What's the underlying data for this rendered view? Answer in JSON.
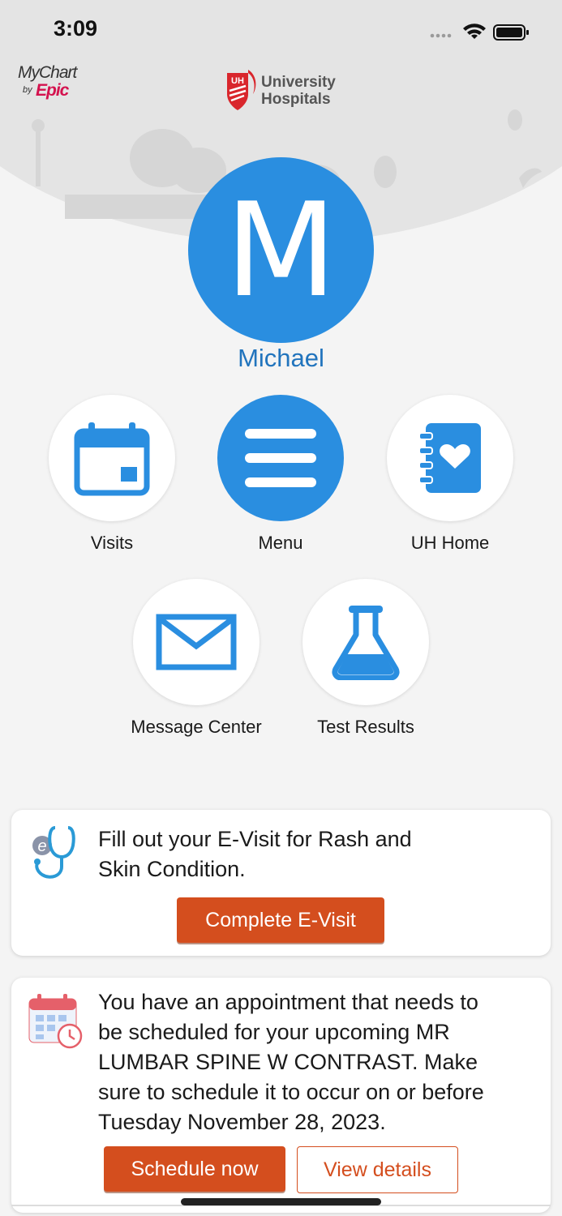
{
  "status_bar": {
    "time": "3:09"
  },
  "branding": {
    "mychart_text": "MyChart",
    "mychart_by": "by",
    "mychart_epic": "Epic",
    "uh_badge": "UH",
    "uh_name_line1": "University",
    "uh_name_line2": "Hospitals"
  },
  "profile": {
    "initial": "M",
    "name": "Michael"
  },
  "shortcuts": [
    {
      "label": "Visits",
      "icon": "calendar-icon"
    },
    {
      "label": "Menu",
      "icon": "hamburger-menu-icon"
    },
    {
      "label": "UH Home",
      "icon": "heart-notebook-icon"
    },
    {
      "label": "Message Center",
      "icon": "envelope-icon"
    },
    {
      "label": "Test Results",
      "icon": "lab-flask-icon"
    }
  ],
  "cards": {
    "evisit": {
      "line1": "Fill out your E-Visit for Rash and",
      "line2": "Skin Condition.",
      "button": "Complete E-Visit",
      "icon": "stethoscope-e-icon"
    },
    "appointment": {
      "lines": [
        "You have an appointment that needs to",
        "be scheduled for your upcoming MR",
        "LUMBAR SPINE W CONTRAST. Make",
        "sure to schedule it to occur on or before",
        "Tuesday November 28, 2023."
      ],
      "primary_button": "Schedule now",
      "secondary_button": "View details",
      "icon": "calendar-clock-icon"
    }
  },
  "colors": {
    "accent_blue": "#2a8ee0",
    "name_blue": "#2174bd",
    "action_orange": "#d44e1e",
    "epic_red": "#d4124e",
    "uh_red": "#d9262c"
  }
}
